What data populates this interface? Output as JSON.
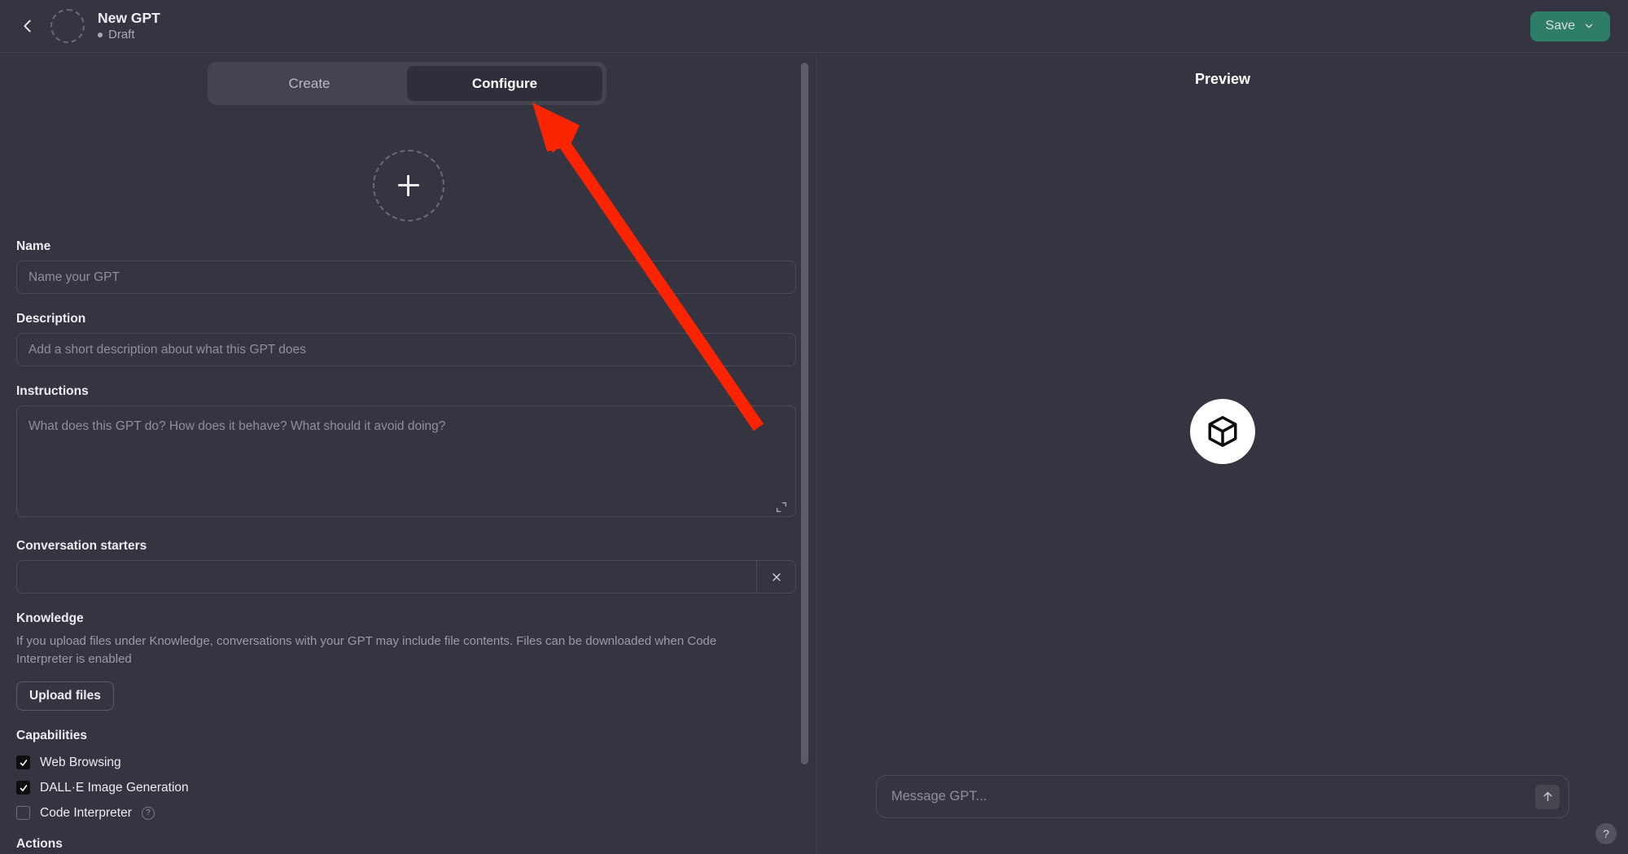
{
  "header": {
    "back_icon": "chevron-left-icon",
    "avatar_icon": "gpt-avatar-placeholder",
    "title": "New GPT",
    "status": "Draft",
    "save_label": "Save",
    "save_caret_icon": "chevron-down-icon",
    "save_color": "#2e7d68"
  },
  "tabs": [
    {
      "label": "Create",
      "active": false
    },
    {
      "label": "Configure",
      "active": true
    }
  ],
  "config": {
    "avatar_upload_icon": "plus-icon",
    "name": {
      "label": "Name",
      "value": "",
      "placeholder": "Name your GPT"
    },
    "description": {
      "label": "Description",
      "value": "",
      "placeholder": "Add a short description about what this GPT does"
    },
    "instructions": {
      "label": "Instructions",
      "value": "",
      "placeholder": "What does this GPT do? How does it behave? What should it avoid doing?",
      "expand_icon": "expand-diagonal-icon"
    },
    "conversation_starters": {
      "label": "Conversation starters",
      "value": "",
      "placeholder": "",
      "remove_icon": "close-x-icon"
    },
    "knowledge": {
      "label": "Knowledge",
      "help": "If you upload files under Knowledge, conversations with your GPT may include file contents. Files can be downloaded when Code Interpreter is enabled",
      "upload_label": "Upload files"
    },
    "capabilities": {
      "label": "Capabilities",
      "items": [
        {
          "label": "Web Browsing",
          "checked": true,
          "help": false
        },
        {
          "label": "DALL·E Image Generation",
          "checked": true,
          "help": false
        },
        {
          "label": "Code Interpreter",
          "checked": false,
          "help": true,
          "help_icon": "question-mark-icon"
        }
      ]
    },
    "actions": {
      "label": "Actions"
    },
    "scrollbar": "vertical-scrollbar"
  },
  "preview": {
    "title": "Preview",
    "placeholder_icon": "cube-3d-icon",
    "message_input": {
      "value": "",
      "placeholder": "Message GPT..."
    },
    "send_icon": "arrow-up-icon",
    "help_label": "?"
  },
  "annotation": {
    "arrow_color": "#fa2400",
    "arrow_target": "Configure"
  }
}
